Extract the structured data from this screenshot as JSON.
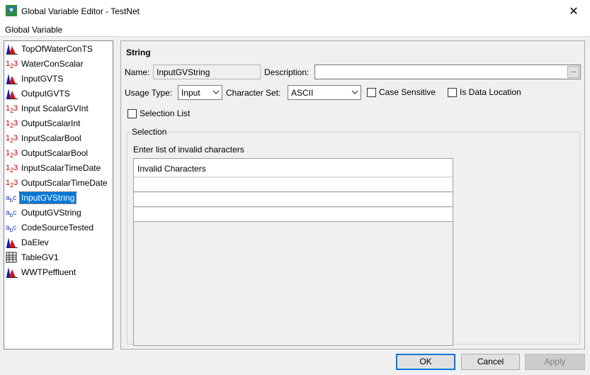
{
  "window": {
    "title": "Global Variable Editor - TestNet",
    "close_glyph": "✕"
  },
  "menu": {
    "label": "Global Variable"
  },
  "tree": {
    "items": [
      {
        "label": "TopOfWaterConTS",
        "icon": "timeseries-icon"
      },
      {
        "label": "WaterConScalar",
        "icon": "scalar-icon"
      },
      {
        "label": "InputGVTS",
        "icon": "timeseries-icon"
      },
      {
        "label": "OutputGVTS",
        "icon": "timeseries-icon"
      },
      {
        "label": "Input ScalarGVInt",
        "icon": "scalar-icon"
      },
      {
        "label": "OutputScalarInt",
        "icon": "scalar-icon"
      },
      {
        "label": "InputScalarBool",
        "icon": "scalar-icon"
      },
      {
        "label": "OutputScalarBool",
        "icon": "scalar-icon"
      },
      {
        "label": "InputScalarTimeDate",
        "icon": "scalar-icon"
      },
      {
        "label": "OutputScalarTimeDate",
        "icon": "scalar-icon"
      },
      {
        "label": "InputGVString",
        "icon": "string-icon",
        "selected": true
      },
      {
        "label": "OutputGVString",
        "icon": "string-icon"
      },
      {
        "label": "CodeSourceTested",
        "icon": "string-icon"
      },
      {
        "label": "DaElev",
        "icon": "timeseries-icon"
      },
      {
        "label": "TableGV1",
        "icon": "table-icon"
      },
      {
        "label": "WWTPeffluent",
        "icon": "timeseries-icon"
      }
    ]
  },
  "form": {
    "section_title": "String",
    "name_label": "Name:",
    "name_value": "InputGVString",
    "description_label": "Description:",
    "description_value": "",
    "ellipsis_label": "...",
    "usage_type_label": "Usage Type:",
    "usage_type_value": "Input",
    "charset_label": "Character Set:",
    "charset_value": "ASCII",
    "case_sensitive_label": "Case Sensitive",
    "is_data_location_label": "Is Data Location",
    "selection_list_label": "Selection List",
    "selection_group_title": "Selection",
    "selection_instruction": "Enter list of invalid characters",
    "grid_header": "Invalid Characters"
  },
  "buttons": {
    "ok": "OK",
    "cancel": "Cancel",
    "apply": "Apply"
  },
  "colors": {
    "selection": "#0078d7",
    "scalar_icon": "#c00000",
    "string_icon": "#1a36c8"
  }
}
